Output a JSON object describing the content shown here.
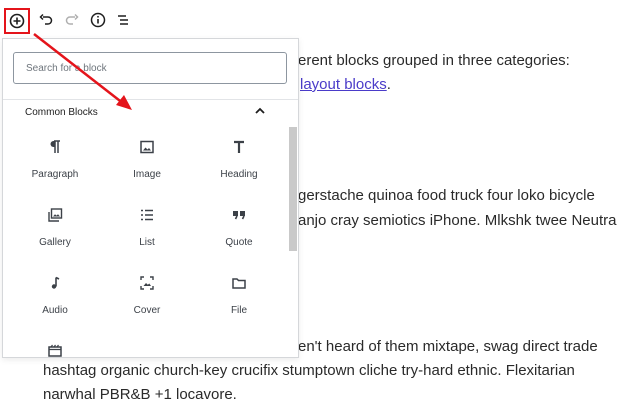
{
  "toolbar": {
    "add_icon": "plus-circle-icon",
    "undo_icon": "undo-icon",
    "redo_icon": "redo-icon",
    "info_icon": "info-icon",
    "outline_icon": "list-outline-icon",
    "highlight_color": "#e4141b"
  },
  "content": {
    "line1": "erent blocks grouped in three categories:",
    "line2_link": "layout blocks",
    "line2_end": ".",
    "line3": "gerstache quinoa food truck four loko bicycle",
    "line4": "anjo cray semiotics iPhone. Mlkshk twee Neutra",
    "line5": "en't heard of them mixtape, swag direct trade",
    "line6": "hashtag organic church-key crucifix stumptown cliche try-hard ethnic. Flexitarian",
    "line7": "narwhal PBR&B +1 locavore.",
    "link_color": "#4a3bc9"
  },
  "inserter": {
    "search_placeholder": "Search for a block",
    "panel_title": "Common Blocks",
    "blocks": [
      {
        "label": "Paragraph",
        "icon": "paragraph-icon"
      },
      {
        "label": "Image",
        "icon": "image-icon"
      },
      {
        "label": "Heading",
        "icon": "heading-icon"
      },
      {
        "label": "Gallery",
        "icon": "gallery-icon"
      },
      {
        "label": "List",
        "icon": "list-icon"
      },
      {
        "label": "Quote",
        "icon": "quote-icon"
      },
      {
        "label": "Audio",
        "icon": "audio-icon"
      },
      {
        "label": "Cover",
        "icon": "cover-icon"
      },
      {
        "label": "File",
        "icon": "file-icon"
      },
      {
        "label": "",
        "icon": "video-icon"
      }
    ]
  },
  "annotation": {
    "arrow_color": "#e4141b"
  }
}
